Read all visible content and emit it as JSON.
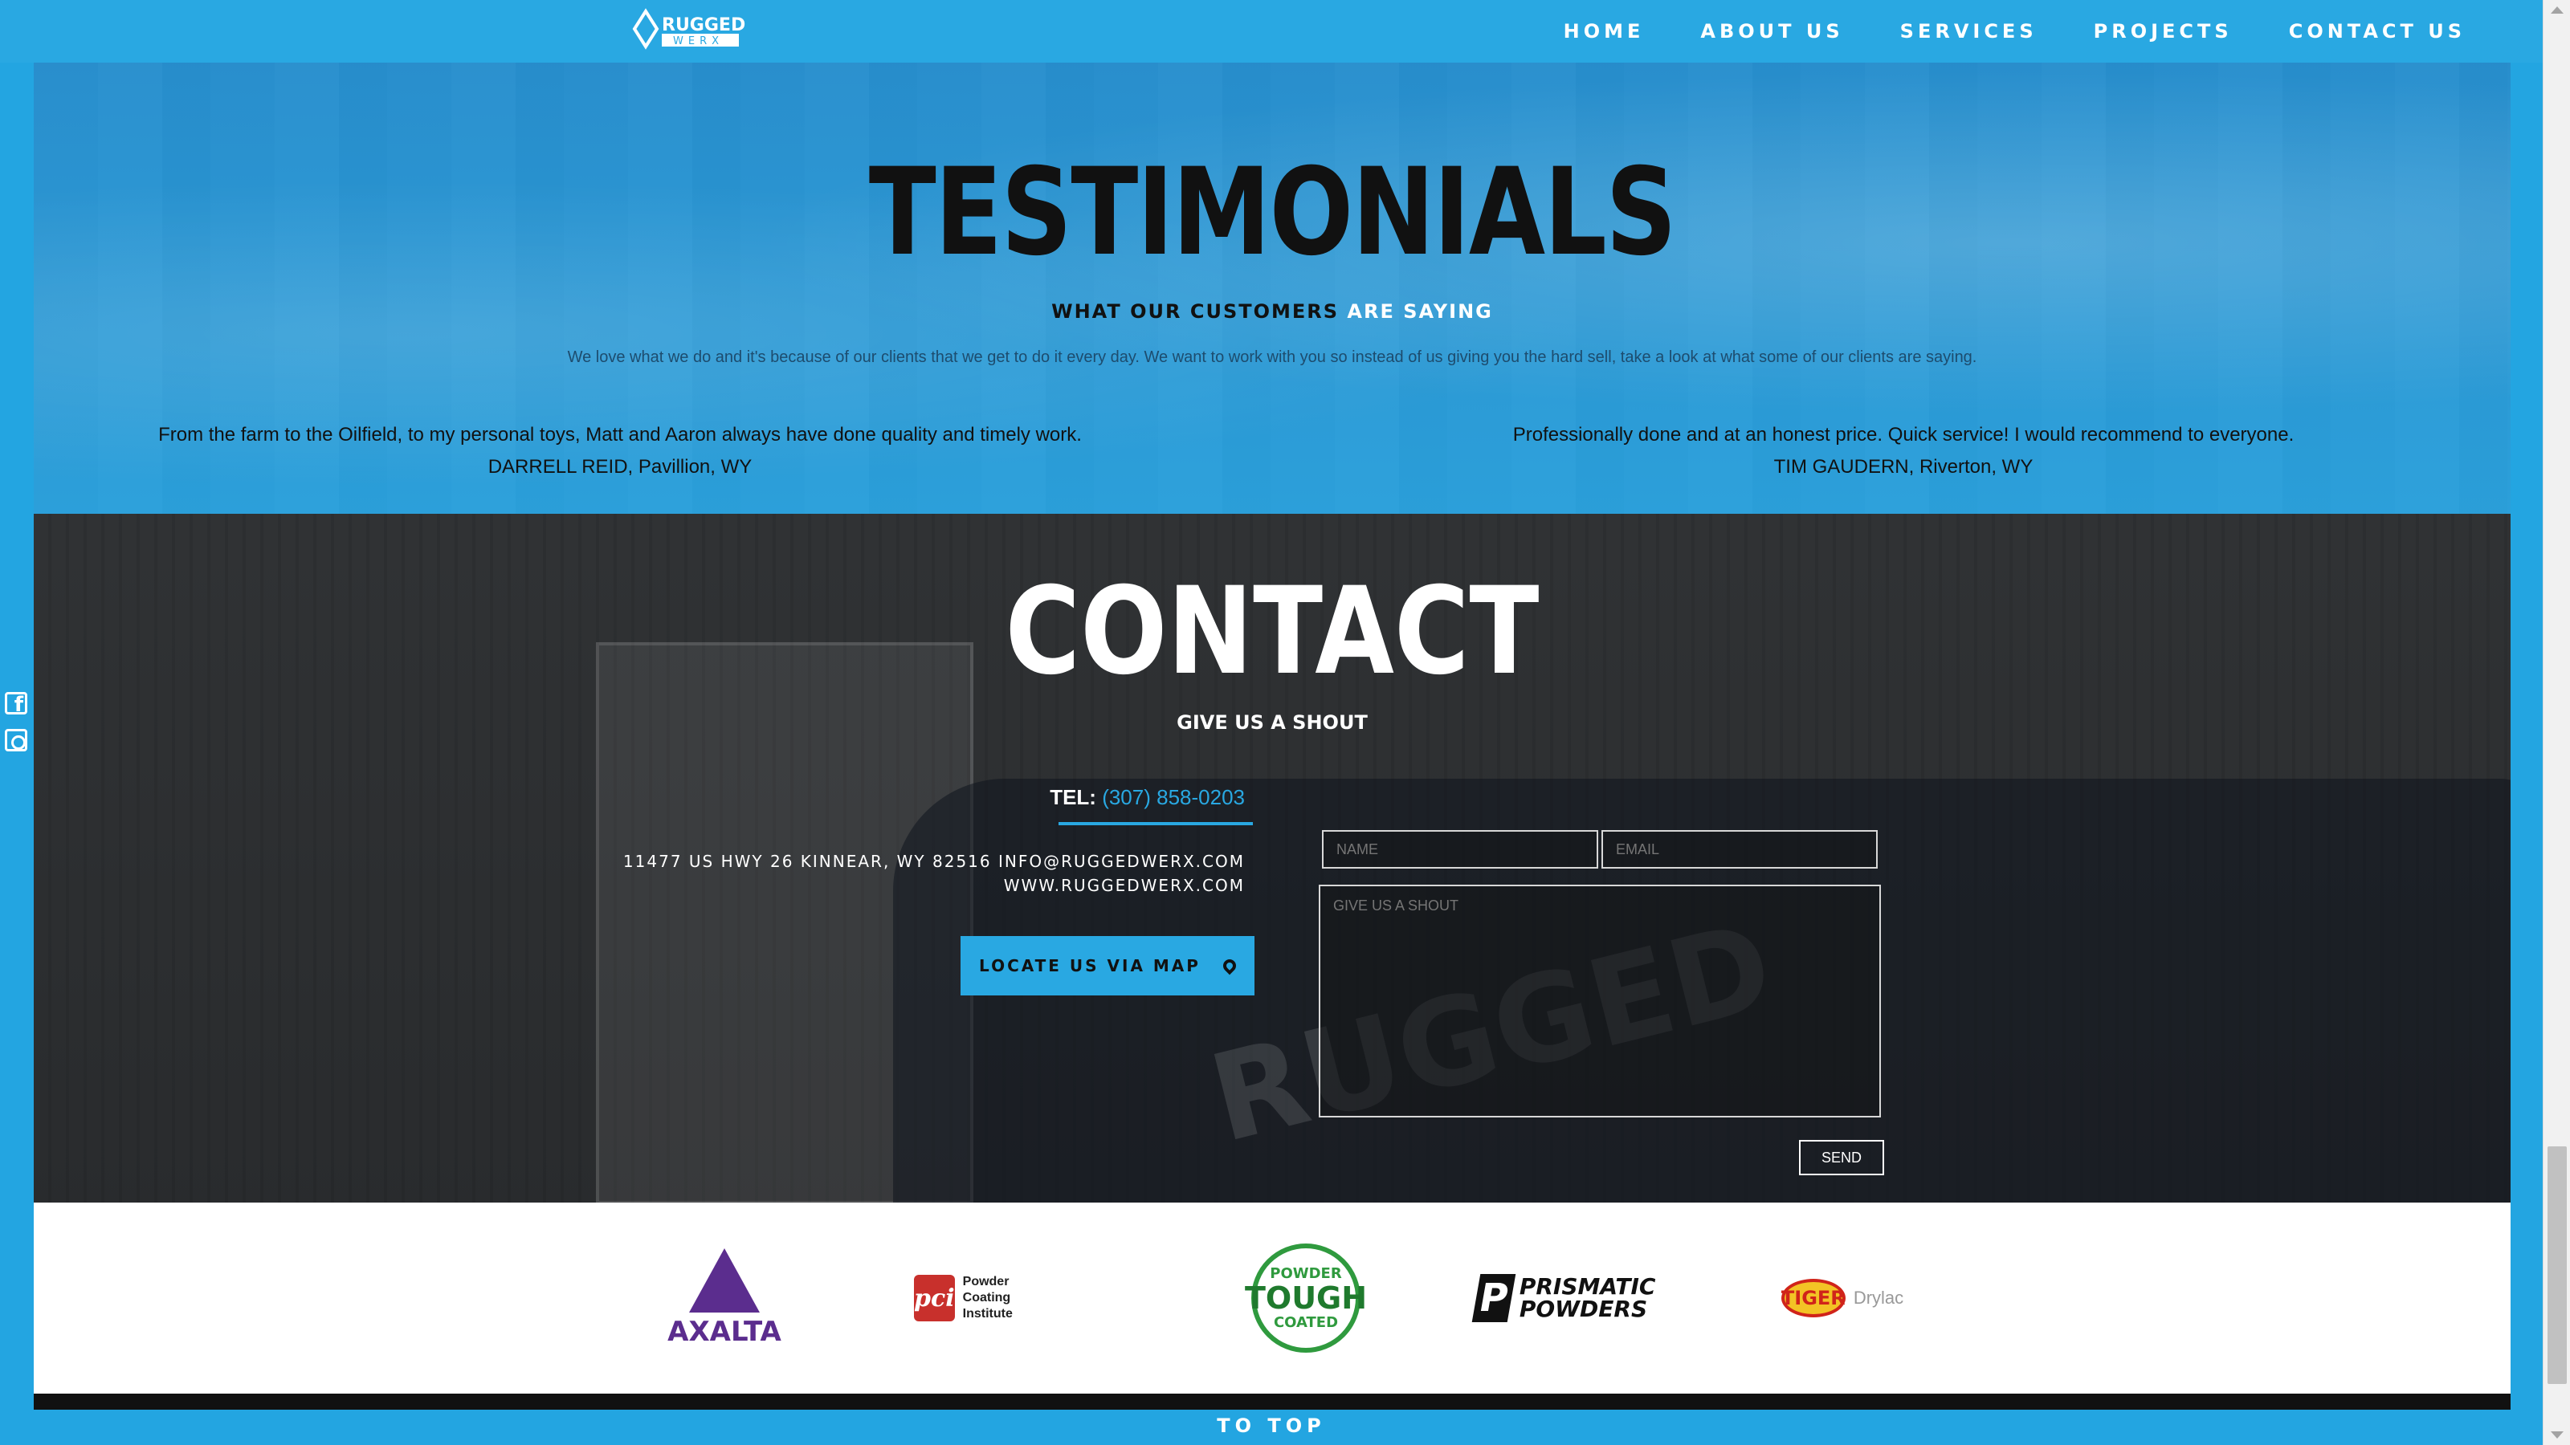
{
  "nav": {
    "logo_text": "RUGGED WERX",
    "items": [
      "HOME",
      "ABOUT US",
      "SERVICES",
      "PROJECTS",
      "CONTACT US"
    ]
  },
  "testimonials": {
    "title": "TESTIMONIALS",
    "subtitle_a": "WHAT OUR ",
    "subtitle_b": "CUSTOMERS",
    "subtitle_c": " ARE SAYING",
    "intro": "We love what we do and it's because of our clients that we get to do it every day. We want to work with you so instead of us giving you the hard sell, take a look at what some of our clients are saying.",
    "quotes": [
      {
        "text": "From the farm to the Oilfield, to my personal toys, Matt and Aaron always have done quality and timely work.",
        "author": "DARRELL REID, Pavillion, WY"
      },
      {
        "text": "Professionally done and at an honest price. Quick service! I would recommend to everyone.",
        "author": "TIM GAUDERN, Riverton, WY"
      }
    ]
  },
  "contact": {
    "title": "CONTACT",
    "subtitle": "GIVE US A SHOUT",
    "tel_label": "TEL: ",
    "tel_number": "(307) 858-0203",
    "address_line1": "11477 US HWY 26 KINNEAR, WY 82516 INFO@RUGGEDWERX.COM",
    "address_line2": "WWW.RUGGEDWERX.COM",
    "map_button": "LOCATE US VIA MAP",
    "form": {
      "name_placeholder": "NAME",
      "email_placeholder": "EMAIL",
      "message_placeholder": "GIVE US A SHOUT",
      "send_label": "SEND"
    }
  },
  "brands": {
    "axalta": "AXALTA",
    "pci": "Powder Coating Institute",
    "tough_top": "POWDER",
    "tough_mid": "TOUGH",
    "tough_bot": "COATED",
    "prismatic": "PRISMATIC POWDERS",
    "tiger": "TIGER",
    "tiger_sub": "Drylac"
  },
  "footer": {
    "to_top": "TO TOP"
  },
  "colors": {
    "accent": "#29a8e2",
    "dark": "#111111"
  },
  "scroll": {
    "position_fraction": 0.92
  }
}
